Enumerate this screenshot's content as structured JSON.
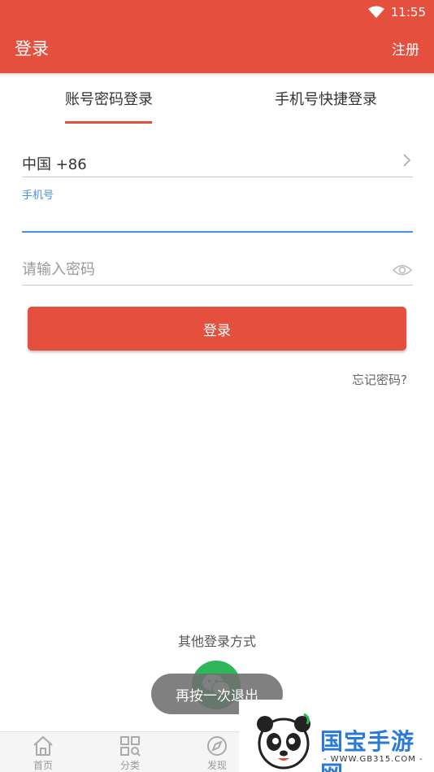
{
  "status_bar": {
    "time": "11:55",
    "icons": [
      "wifi-icon"
    ]
  },
  "app_bar": {
    "title": "登录",
    "register_label": "注册",
    "color": "#e5503e"
  },
  "tabs": [
    {
      "label": "账号密码登录",
      "active": true
    },
    {
      "label": "手机号快捷登录",
      "active": false
    }
  ],
  "form": {
    "country_code": "中国 +86",
    "phone_label": "手机号",
    "phone_value": "",
    "password_placeholder": "请输入密码",
    "login_button": "登录",
    "forgot_password": "忘记密码?"
  },
  "other_login": {
    "label": "其他登录方式",
    "icons": [
      "wechat-icon"
    ]
  },
  "toast": "再按一次退出",
  "bottom_nav": [
    {
      "label": "首页",
      "icon": "home-icon"
    },
    {
      "label": "分类",
      "icon": "category-icon"
    },
    {
      "label": "发现",
      "icon": "discover-icon"
    }
  ],
  "watermark": {
    "brand": "国宝手游网",
    "url": "- WWW.GB315.COM -"
  }
}
